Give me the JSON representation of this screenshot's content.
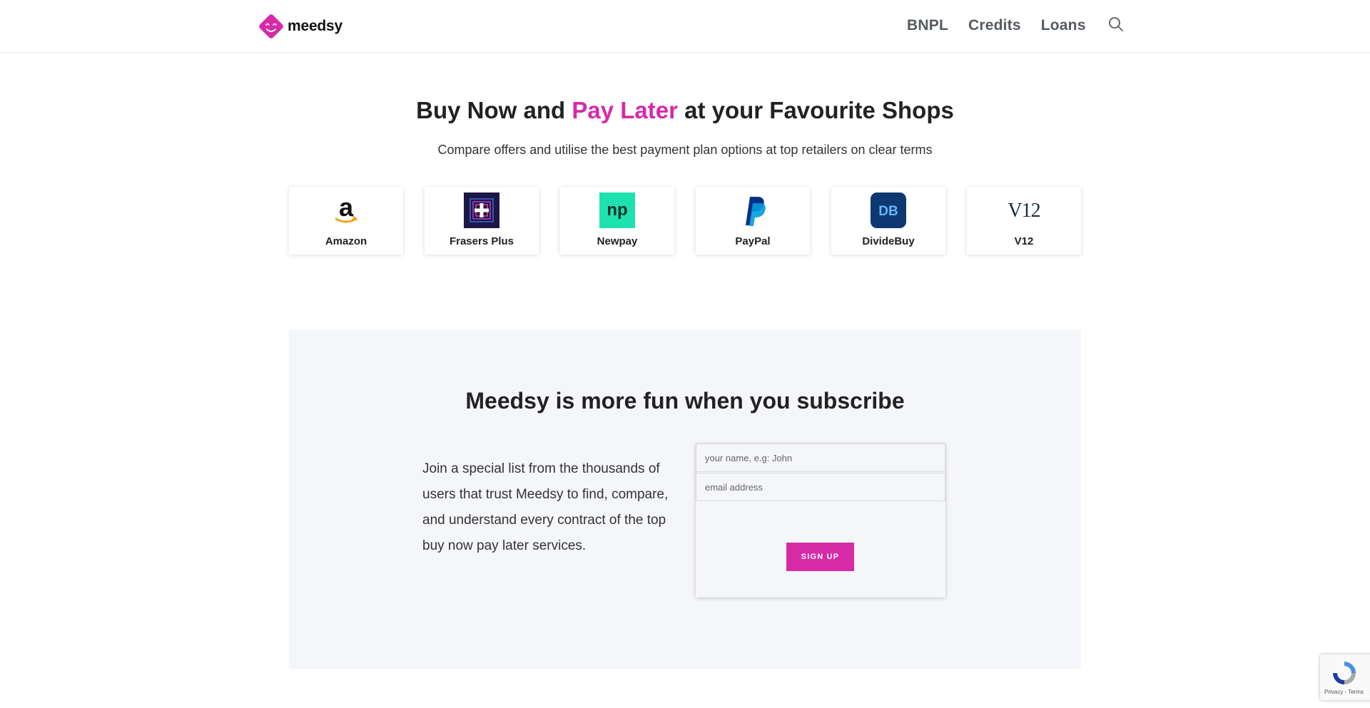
{
  "header": {
    "logo_text": "meedsy",
    "nav": [
      {
        "label": "BNPL"
      },
      {
        "label": "Credits"
      },
      {
        "label": "Loans"
      }
    ],
    "search_icon": "search-icon"
  },
  "hero": {
    "title_before": "Buy Now and ",
    "title_accent": "Pay Later",
    "title_after": " at your Favourite Shops",
    "subtitle": "Compare offers and utilise the best payment plan options at top retailers on clear terms"
  },
  "shops": [
    {
      "name": "Amazon",
      "icon": "amazon-logo-icon"
    },
    {
      "name": "Frasers Plus",
      "icon": "frasers-plus-logo-icon"
    },
    {
      "name": "Newpay",
      "icon": "newpay-logo-icon"
    },
    {
      "name": "PayPal",
      "icon": "paypal-logo-icon"
    },
    {
      "name": "DivideBuy",
      "icon": "dividebuy-logo-icon"
    },
    {
      "name": "V12",
      "icon": "v12-logo-icon"
    }
  ],
  "subscribe": {
    "title": "Meedsy is more fun when you subscribe",
    "text": "Join a special list from the thousands of users that trust Meedsy to find, compare, and understand every contract of the top buy now pay later services.",
    "name_placeholder": "your name, e.g: John",
    "email_placeholder": "email address",
    "button_label": "SIGN UP"
  },
  "recaptcha": {
    "links": "Privacy - Terms"
  },
  "colors": {
    "accent": "#d62aa7",
    "subscribe_bg": "#f5f6fa",
    "newpay_bg": "#1de2b0",
    "dividebuy_bg": "#0e3872",
    "frasers_bg": "#1c1744"
  }
}
